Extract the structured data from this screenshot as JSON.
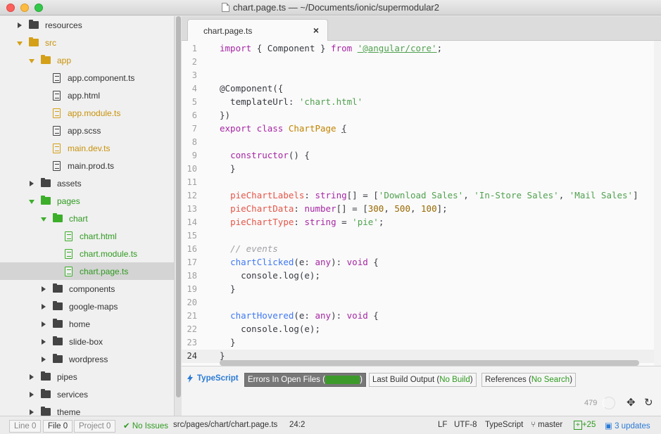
{
  "window": {
    "title": "chart.page.ts — ~/Documents/ionic/supermodular2"
  },
  "tree": [
    {
      "label": "resources",
      "type": "folder",
      "state": "collapsed",
      "depth": 1,
      "color": "default"
    },
    {
      "label": "src",
      "type": "folder",
      "state": "expanded",
      "depth": 1,
      "color": "yellow"
    },
    {
      "label": "app",
      "type": "folder",
      "state": "expanded",
      "depth": 2,
      "color": "yellow"
    },
    {
      "label": "app.component.ts",
      "type": "file",
      "depth": 3,
      "color": "default"
    },
    {
      "label": "app.html",
      "type": "file",
      "depth": 3,
      "color": "default"
    },
    {
      "label": "app.module.ts",
      "type": "file",
      "depth": 3,
      "color": "yellow"
    },
    {
      "label": "app.scss",
      "type": "file",
      "depth": 3,
      "color": "default"
    },
    {
      "label": "main.dev.ts",
      "type": "file",
      "depth": 3,
      "color": "yellow"
    },
    {
      "label": "main.prod.ts",
      "type": "file",
      "depth": 3,
      "color": "default"
    },
    {
      "label": "assets",
      "type": "folder",
      "state": "collapsed",
      "depth": 2,
      "color": "default"
    },
    {
      "label": "pages",
      "type": "folder",
      "state": "expanded",
      "depth": 2,
      "color": "green"
    },
    {
      "label": "chart",
      "type": "folder",
      "state": "expanded",
      "depth": 3,
      "color": "green"
    },
    {
      "label": "chart.html",
      "type": "file",
      "depth": 4,
      "color": "green"
    },
    {
      "label": "chart.module.ts",
      "type": "file",
      "depth": 4,
      "color": "green"
    },
    {
      "label": "chart.page.ts",
      "type": "file",
      "depth": 4,
      "color": "green",
      "selected": true
    },
    {
      "label": "components",
      "type": "folder",
      "state": "collapsed",
      "depth": 3,
      "color": "default"
    },
    {
      "label": "google-maps",
      "type": "folder",
      "state": "collapsed",
      "depth": 3,
      "color": "default"
    },
    {
      "label": "home",
      "type": "folder",
      "state": "collapsed",
      "depth": 3,
      "color": "default"
    },
    {
      "label": "slide-box",
      "type": "folder",
      "state": "collapsed",
      "depth": 3,
      "color": "default"
    },
    {
      "label": "wordpress",
      "type": "folder",
      "state": "collapsed",
      "depth": 3,
      "color": "default"
    },
    {
      "label": "pipes",
      "type": "folder",
      "state": "collapsed",
      "depth": 2,
      "color": "default"
    },
    {
      "label": "services",
      "type": "folder",
      "state": "collapsed",
      "depth": 2,
      "color": "default"
    },
    {
      "label": "theme",
      "type": "folder",
      "state": "collapsed",
      "depth": 2,
      "color": "default"
    }
  ],
  "tab": {
    "label": "chart.page.ts",
    "close": "×"
  },
  "editor": {
    "current_line": 24,
    "lines": [
      [
        [
          "kw",
          "import"
        ],
        [
          "",
          "{ Component } "
        ],
        [
          "kw",
          "from"
        ],
        [
          "",
          ""
        ],
        [
          "str ul",
          "'@angular/core'"
        ],
        [
          "",
          ";"
        ]
      ],
      [],
      [],
      [
        [
          "",
          "@Component({"
        ]
      ],
      [
        [
          "",
          "  templateUrl: "
        ],
        [
          "str",
          "'chart.html'"
        ]
      ],
      [
        [
          "",
          "})"
        ]
      ],
      [
        [
          "kw",
          "export class "
        ],
        [
          "cls",
          "ChartPage "
        ],
        [
          "ul",
          "{"
        ]
      ],
      [],
      [
        [
          "",
          "  "
        ],
        [
          "kw",
          "constructor"
        ],
        [
          "",
          "() {"
        ]
      ],
      [
        [
          "",
          "  }"
        ]
      ],
      [],
      [
        [
          "",
          "  "
        ],
        [
          "prop",
          "pieChartLabels"
        ],
        [
          "",
          ": "
        ],
        [
          "kw",
          "string"
        ],
        [
          "",
          "[] = ["
        ],
        [
          "str",
          "'Download Sales'"
        ],
        [
          "",
          ", "
        ],
        [
          "str",
          "'In-Store Sales'"
        ],
        [
          "",
          ", "
        ],
        [
          "str",
          "'Mail Sales'"
        ],
        [
          "",
          "]"
        ]
      ],
      [
        [
          "",
          "  "
        ],
        [
          "prop",
          "pieChartData"
        ],
        [
          "",
          ": "
        ],
        [
          "kw",
          "number"
        ],
        [
          "",
          "[] = ["
        ],
        [
          "num",
          "300"
        ],
        [
          "",
          ", "
        ],
        [
          "num",
          "500"
        ],
        [
          "",
          ", "
        ],
        [
          "num",
          "100"
        ],
        [
          "",
          "];"
        ]
      ],
      [
        [
          "",
          "  "
        ],
        [
          "prop",
          "pieChartType"
        ],
        [
          "",
          ": "
        ],
        [
          "kw",
          "string"
        ],
        [
          "",
          " = "
        ],
        [
          "str",
          "'pie'"
        ],
        [
          "",
          ";"
        ]
      ],
      [],
      [
        [
          "",
          "  "
        ],
        [
          "cmt",
          "// events"
        ]
      ],
      [
        [
          "",
          "  "
        ],
        [
          "fn",
          "chartClicked"
        ],
        [
          "",
          "(e: "
        ],
        [
          "kw",
          "any"
        ],
        [
          "",
          "): "
        ],
        [
          "kw",
          "void"
        ],
        [
          "",
          " {"
        ]
      ],
      [
        [
          "",
          "    console.log(e);"
        ]
      ],
      [
        [
          "",
          "  }"
        ]
      ],
      [],
      [
        [
          "",
          "  "
        ],
        [
          "fn",
          "chartHovered"
        ],
        [
          "",
          "(e: "
        ],
        [
          "kw",
          "any"
        ],
        [
          "",
          "): "
        ],
        [
          "kw",
          "void"
        ],
        [
          "",
          " {"
        ]
      ],
      [
        [
          "",
          "    console.log(e);"
        ]
      ],
      [
        [
          "",
          "  }"
        ]
      ],
      [
        [
          "",
          "}"
        ]
      ]
    ]
  },
  "typescript_panel": {
    "brand": "TypeScript",
    "errors_tab": {
      "label": "Errors In Open Files (",
      "status": "No Errors",
      "close": ")"
    },
    "build_tab": {
      "label": "Last Build Output (",
      "status": "No Build",
      "close": ")"
    },
    "refs_tab": {
      "label": "References (",
      "status": "No Search",
      "close": ")"
    },
    "count": "479"
  },
  "status": {
    "line_label": "Line",
    "line_count": "0",
    "file_label": "File",
    "file_count": "0",
    "project_label": "Project",
    "project_count": "0",
    "issues": "No Issues",
    "path": "src/pages/chart/chart.page.ts",
    "cursor": "24:2",
    "line_ending": "LF",
    "encoding": "UTF-8",
    "grammar": "TypeScript",
    "branch": "master",
    "diff": "+25",
    "updates": "3 updates"
  }
}
